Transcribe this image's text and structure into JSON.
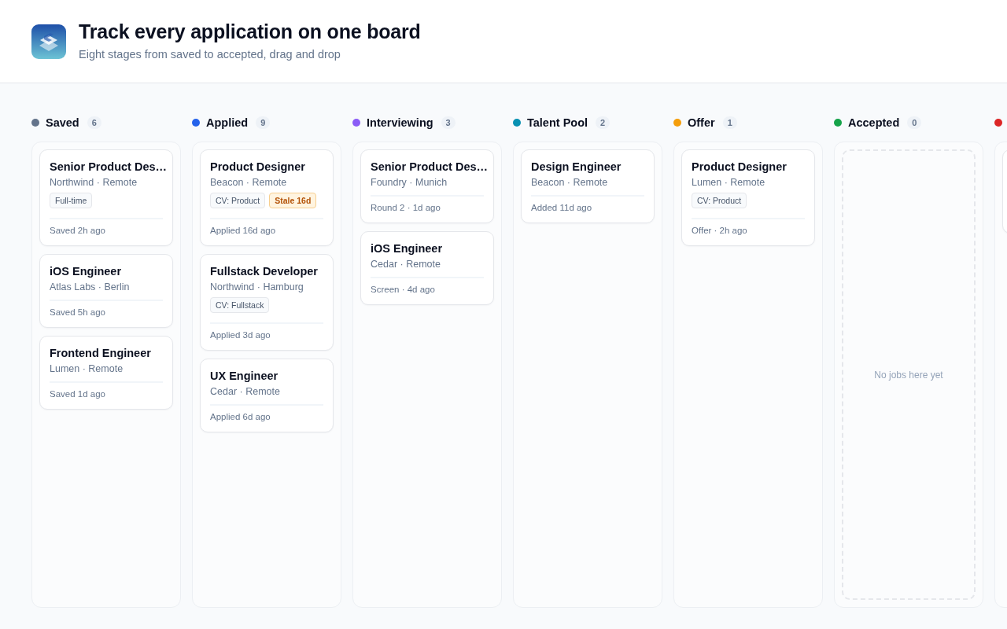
{
  "header": {
    "title": "Track every application on one board",
    "subtitle": "Eight stages from saved to accepted, drag and drop"
  },
  "columns": [
    {
      "label": "Saved",
      "count": "6",
      "color": "#64748b",
      "cards": [
        {
          "title": "Senior Product Des…",
          "company": "Northwind · Remote",
          "tags": [
            {
              "text": "Full-time",
              "kind": "neutral"
            }
          ],
          "footer": "Saved 2h ago"
        },
        {
          "title": "iOS Engineer",
          "company": "Atlas Labs · Berlin",
          "footer": "Saved 5h ago"
        },
        {
          "title": "Frontend Engineer",
          "company": "Lumen · Remote",
          "footer": "Saved 1d ago"
        }
      ]
    },
    {
      "label": "Applied",
      "count": "9",
      "color": "#2563eb",
      "cards": [
        {
          "title": "Product Designer",
          "company": "Beacon · Remote",
          "tags": [
            {
              "text": "CV: Product",
              "kind": "neutral"
            },
            {
              "text": "Stale 16d",
              "kind": "warning"
            }
          ],
          "footer": "Applied 16d ago"
        },
        {
          "title": "Fullstack Developer",
          "company": "Northwind · Hamburg",
          "tags": [
            {
              "text": "CV: Fullstack",
              "kind": "neutral"
            }
          ],
          "footer": "Applied 3d ago"
        },
        {
          "title": "UX Engineer",
          "company": "Cedar · Remote",
          "footer": "Applied 6d ago"
        }
      ]
    },
    {
      "label": "Interviewing",
      "count": "3",
      "color": "#8b5cf6",
      "cards": [
        {
          "title": "Senior Product Des…",
          "company": "Foundry · Munich",
          "footer": "Round 2 · 1d ago"
        },
        {
          "title": "iOS Engineer",
          "company": "Cedar · Remote",
          "footer": "Screen · 4d ago"
        }
      ]
    },
    {
      "label": "Talent Pool",
      "count": "2",
      "color": "#0891b2",
      "cards": [
        {
          "title": "Design Engineer",
          "company": "Beacon · Remote",
          "footer": "Added 11d ago"
        }
      ]
    },
    {
      "label": "Offer",
      "count": "1",
      "color": "#f59e0b",
      "cards": [
        {
          "title": "Product Designer",
          "company": "Lumen · Remote",
          "tags": [
            {
              "text": "CV: Product",
              "kind": "neutral"
            }
          ],
          "footer": "Offer · 2h ago"
        }
      ]
    },
    {
      "label": "Accepted",
      "count": "0",
      "color": "#16a34a",
      "empty_text": "No jobs here yet"
    },
    {
      "color": "#dc2626",
      "cards": [
        {
          "kind": "job"
        }
      ]
    }
  ]
}
